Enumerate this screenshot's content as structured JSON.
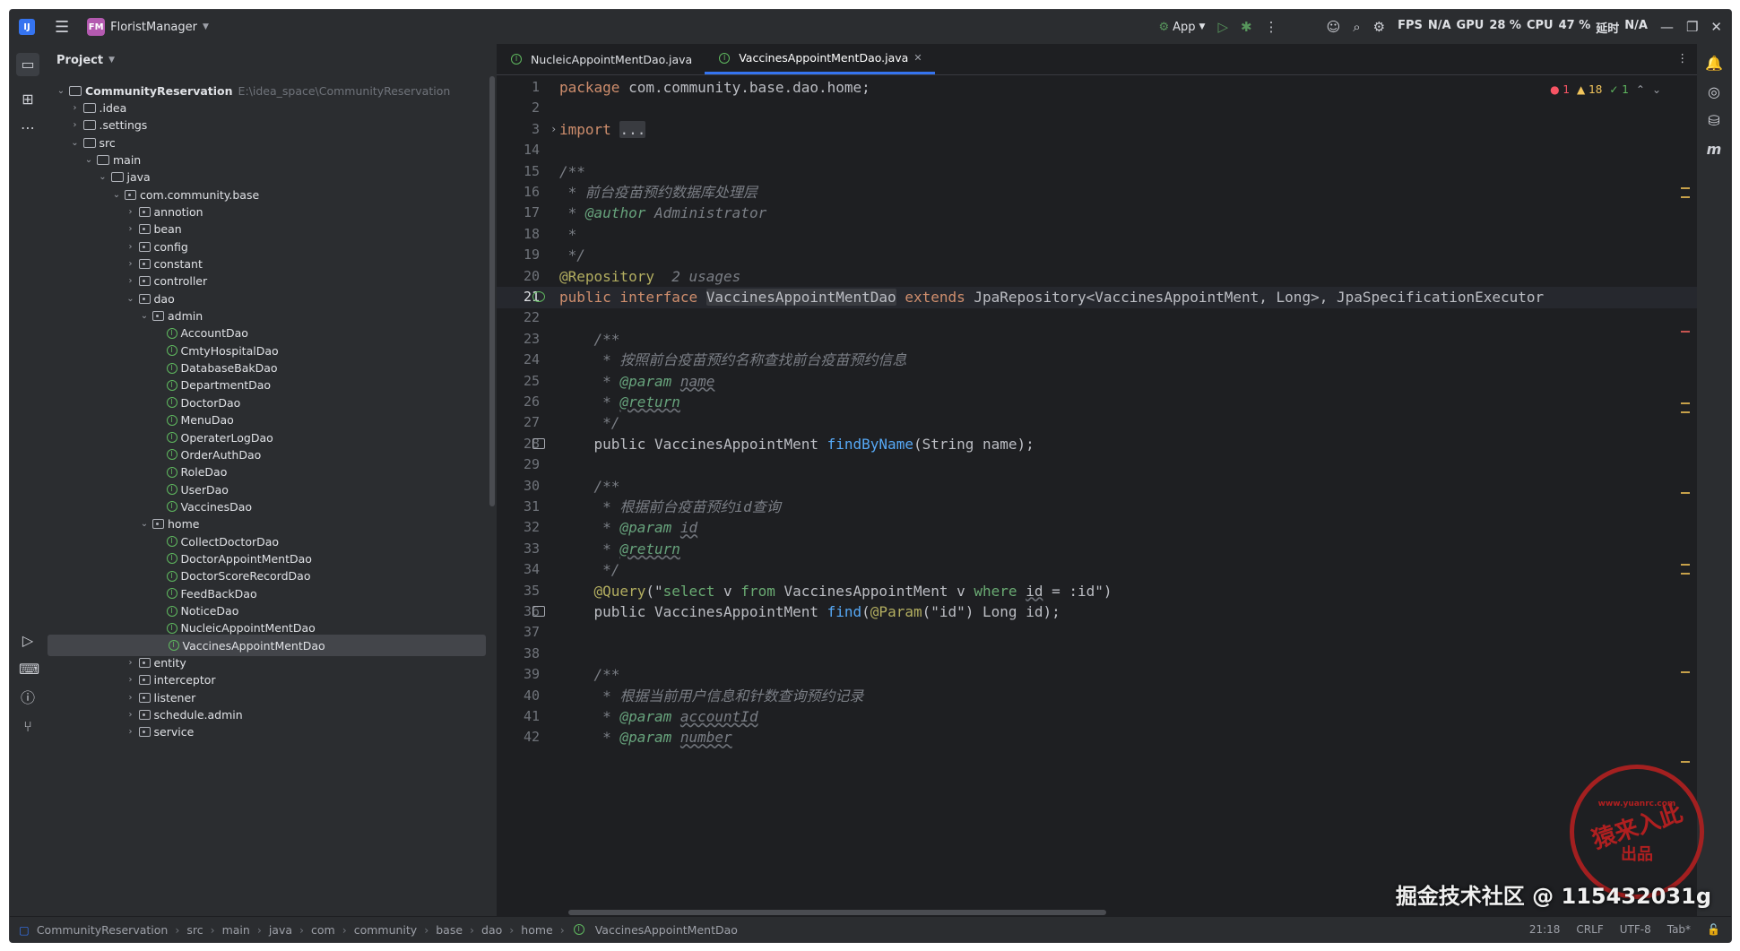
{
  "titlebar": {
    "project_badge": "FM",
    "project_name": "FloristManager",
    "run_config": "App",
    "stats": [
      "FPS",
      "N/A",
      "GPU",
      "28 %",
      "CPU",
      "47 %",
      "延时",
      "N/A"
    ]
  },
  "project_panel": {
    "title": "Project",
    "tree": [
      {
        "label": "CommunityReservation",
        "path": "E:\\idea_space\\CommunityReservation",
        "depth": 0,
        "kind": "module",
        "open": true,
        "bold": true
      },
      {
        "label": ".idea",
        "depth": 1,
        "kind": "folder",
        "open": false
      },
      {
        "label": ".settings",
        "depth": 1,
        "kind": "folder",
        "open": false
      },
      {
        "label": "src",
        "depth": 1,
        "kind": "folder",
        "open": true
      },
      {
        "label": "main",
        "depth": 2,
        "kind": "folder",
        "open": true
      },
      {
        "label": "java",
        "depth": 3,
        "kind": "folder",
        "open": true
      },
      {
        "label": "com.community.base",
        "depth": 4,
        "kind": "package",
        "open": true
      },
      {
        "label": "annotion",
        "depth": 5,
        "kind": "package",
        "open": false
      },
      {
        "label": "bean",
        "depth": 5,
        "kind": "package",
        "open": false
      },
      {
        "label": "config",
        "depth": 5,
        "kind": "package",
        "open": false
      },
      {
        "label": "constant",
        "depth": 5,
        "kind": "package",
        "open": false
      },
      {
        "label": "controller",
        "depth": 5,
        "kind": "package",
        "open": false
      },
      {
        "label": "dao",
        "depth": 5,
        "kind": "package",
        "open": true
      },
      {
        "label": "admin",
        "depth": 6,
        "kind": "package",
        "open": true
      },
      {
        "label": "AccountDao",
        "depth": 7,
        "kind": "interface"
      },
      {
        "label": "CmtyHospitalDao",
        "depth": 7,
        "kind": "interface"
      },
      {
        "label": "DatabaseBakDao",
        "depth": 7,
        "kind": "interface"
      },
      {
        "label": "DepartmentDao",
        "depth": 7,
        "kind": "interface"
      },
      {
        "label": "DoctorDao",
        "depth": 7,
        "kind": "interface"
      },
      {
        "label": "MenuDao",
        "depth": 7,
        "kind": "interface"
      },
      {
        "label": "OperaterLogDao",
        "depth": 7,
        "kind": "interface"
      },
      {
        "label": "OrderAuthDao",
        "depth": 7,
        "kind": "interface"
      },
      {
        "label": "RoleDao",
        "depth": 7,
        "kind": "interface"
      },
      {
        "label": "UserDao",
        "depth": 7,
        "kind": "interface"
      },
      {
        "label": "VaccinesDao",
        "depth": 7,
        "kind": "interface"
      },
      {
        "label": "home",
        "depth": 6,
        "kind": "package",
        "open": true
      },
      {
        "label": "CollectDoctorDao",
        "depth": 7,
        "kind": "interface"
      },
      {
        "label": "DoctorAppointMentDao",
        "depth": 7,
        "kind": "interface"
      },
      {
        "label": "DoctorScoreRecordDao",
        "depth": 7,
        "kind": "interface"
      },
      {
        "label": "FeedBackDao",
        "depth": 7,
        "kind": "interface"
      },
      {
        "label": "NoticeDao",
        "depth": 7,
        "kind": "interface"
      },
      {
        "label": "NucleicAppointMentDao",
        "depth": 7,
        "kind": "interface"
      },
      {
        "label": "VaccinesAppointMentDao",
        "depth": 7,
        "kind": "interface",
        "selected": true
      },
      {
        "label": "entity",
        "depth": 5,
        "kind": "package",
        "open": false
      },
      {
        "label": "interceptor",
        "depth": 5,
        "kind": "package",
        "open": false
      },
      {
        "label": "listener",
        "depth": 5,
        "kind": "package",
        "open": false
      },
      {
        "label": "schedule.admin",
        "depth": 5,
        "kind": "package",
        "open": false
      },
      {
        "label": "service",
        "depth": 5,
        "kind": "package",
        "open": false
      }
    ]
  },
  "editor": {
    "tabs": [
      {
        "label": "NucleicAppointMentDao.java",
        "active": false
      },
      {
        "label": "VaccinesAppointMentDao.java",
        "active": true
      }
    ],
    "inspections": {
      "errors": "1",
      "warnings": "18",
      "ok": "1"
    },
    "line_numbers": [
      "1",
      "2",
      "3",
      "14",
      "15",
      "16",
      "17",
      "18",
      "19",
      "20",
      "21",
      "22",
      "23",
      "24",
      "25",
      "26",
      "27",
      "28",
      "29",
      "30",
      "31",
      "32",
      "33",
      "34",
      "35",
      "36",
      "37",
      "38",
      "39",
      "40",
      "41",
      "42"
    ],
    "current_line_index": 10,
    "code_lines": [
      [
        [
          "kw",
          "package "
        ],
        [
          "",
          "com.community.base.dao.home;"
        ]
      ],
      [],
      [
        [
          "kw",
          "import "
        ],
        [
          "hl",
          "..."
        ]
      ],
      [],
      [
        [
          "cm",
          "/**"
        ]
      ],
      [
        [
          "cm",
          " * 前台疫苗预约数据库处理层"
        ]
      ],
      [
        [
          "cm",
          " * "
        ],
        [
          "tag",
          "@author"
        ],
        [
          "cm",
          " Administrator"
        ]
      ],
      [
        [
          "cm",
          " *"
        ]
      ],
      [
        [
          "cm",
          " */"
        ]
      ],
      [
        [
          "ann",
          "@Repository"
        ],
        [
          "cm",
          "  2 usages"
        ]
      ],
      [
        [
          "kw",
          "public interface "
        ],
        [
          "hl",
          "VaccinesAppointMentDao"
        ],
        [
          "kw",
          " extends "
        ],
        [
          "",
          "JpaRepository<VaccinesAppointMent, Long>, JpaSpecificationExecutor"
        ]
      ],
      [],
      [
        [
          "cm",
          "    /**"
        ]
      ],
      [
        [
          "cm",
          "     * 按照前台疫苗预约名称查找前台疫苗预约信息"
        ]
      ],
      [
        [
          "cm",
          "     * "
        ],
        [
          "tag",
          "@param "
        ],
        [
          "cmu",
          "name"
        ]
      ],
      [
        [
          "cm",
          "     * "
        ],
        [
          "tagu",
          "@return"
        ]
      ],
      [
        [
          "cm",
          "     */"
        ]
      ],
      [
        [
          "",
          "    public VaccinesAppointMent "
        ],
        [
          "fn",
          "findByName"
        ],
        [
          "",
          "(String name);"
        ]
      ],
      [],
      [
        [
          "cm",
          "    /**"
        ]
      ],
      [
        [
          "cm",
          "     * 根据前台疫苗预约id查询"
        ]
      ],
      [
        [
          "cm",
          "     * "
        ],
        [
          "tag",
          "@param "
        ],
        [
          "cmu",
          "id"
        ]
      ],
      [
        [
          "cm",
          "     * "
        ],
        [
          "tagu",
          "@return"
        ]
      ],
      [
        [
          "cm",
          "     */"
        ]
      ],
      [
        [
          "ann",
          "    @Query"
        ],
        [
          "",
          "(\""
        ],
        [
          "str",
          "select "
        ],
        [
          "",
          "v "
        ],
        [
          "str",
          "from "
        ],
        [
          "",
          "VaccinesAppointMent v "
        ],
        [
          "str",
          "where "
        ],
        [
          "ulp",
          "id"
        ],
        [
          "",
          " = :id\")"
        ]
      ],
      [
        [
          "",
          "    public VaccinesAppointMent "
        ],
        [
          "fn",
          "find"
        ],
        [
          "",
          "("
        ],
        [
          "ann",
          "@Param"
        ],
        [
          "",
          "(\"id\") Long id);"
        ]
      ],
      [],
      [],
      [
        [
          "cm",
          "    /**"
        ]
      ],
      [
        [
          "cm",
          "     * 根据当前用户信息和针数查询预约记录"
        ]
      ],
      [
        [
          "cm",
          "     * "
        ],
        [
          "tag",
          "@param "
        ],
        [
          "cmu",
          "accountId"
        ]
      ],
      [
        [
          "cm",
          "     * "
        ],
        [
          "tag",
          "@param "
        ],
        [
          "cmu",
          "number"
        ]
      ]
    ]
  },
  "statusbar": {
    "breadcrumb": [
      "CommunityReservation",
      "src",
      "main",
      "java",
      "com",
      "community",
      "base",
      "dao",
      "home",
      "VaccinesAppointMentDao"
    ],
    "position": "21:18",
    "line_sep": "CRLF",
    "encoding": "UTF-8",
    "indent": "Tab*"
  },
  "watermark": {
    "text": "掘金技术社区 @ 115432031g",
    "stamp_top": "www.yuanrc.com",
    "stamp_main": "猿来入此",
    "stamp_bottom": "出品"
  }
}
